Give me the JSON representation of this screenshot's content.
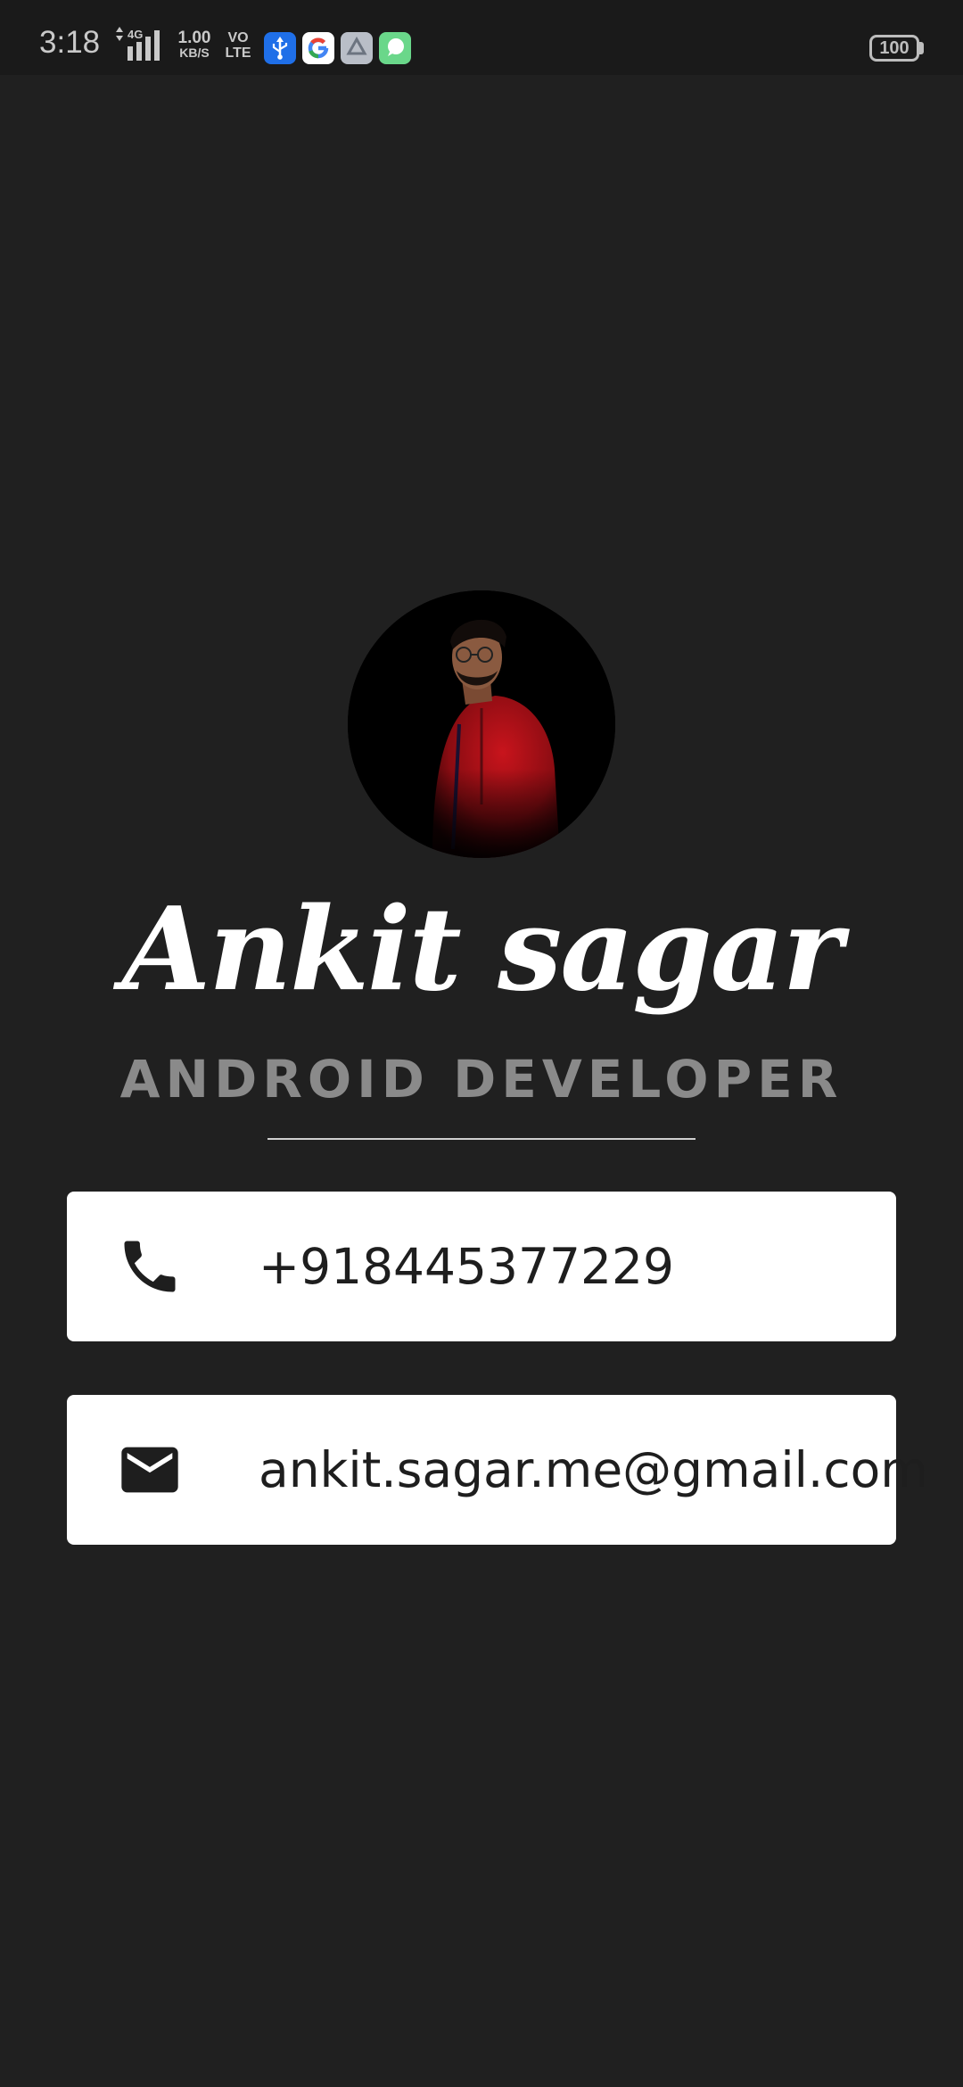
{
  "status_bar": {
    "time": "3:18",
    "network_type": "4G",
    "speed_value": "1.00",
    "speed_unit": "KB/S",
    "volte_top": "VO",
    "volte_bottom": "LTE",
    "battery": "100",
    "notification_icons": [
      "usb-icon",
      "google-icon",
      "drive-icon",
      "chat-icon"
    ]
  },
  "profile": {
    "name": "Ankit sagar",
    "role": "ANDROID DEVELOPER"
  },
  "contacts": {
    "phone": {
      "icon": "phone-icon",
      "value": "+918445377229"
    },
    "email": {
      "icon": "mail-icon",
      "value": "ankit.sagar.me@gmail.com"
    }
  },
  "colors": {
    "background": "#202020",
    "status_bar": "#1a1a1a",
    "card": "#ffffff",
    "card_text": "#1e1e1e",
    "role_text": "#8a8a8a",
    "name_text": "#ffffff"
  }
}
